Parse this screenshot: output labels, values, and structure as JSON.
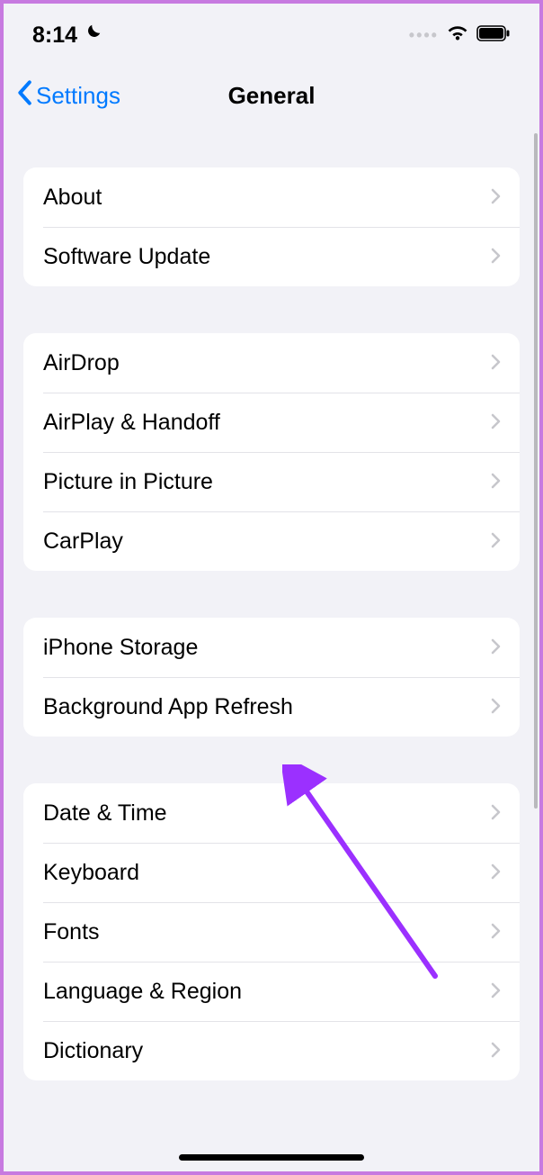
{
  "status": {
    "time": "8:14"
  },
  "nav": {
    "back_label": "Settings",
    "title": "General"
  },
  "sections": [
    {
      "rows": [
        "About",
        "Software Update"
      ]
    },
    {
      "rows": [
        "AirDrop",
        "AirPlay & Handoff",
        "Picture in Picture",
        "CarPlay"
      ]
    },
    {
      "rows": [
        "iPhone Storage",
        "Background App Refresh"
      ]
    },
    {
      "rows": [
        "Date & Time",
        "Keyboard",
        "Fonts",
        "Language & Region",
        "Dictionary"
      ]
    }
  ]
}
